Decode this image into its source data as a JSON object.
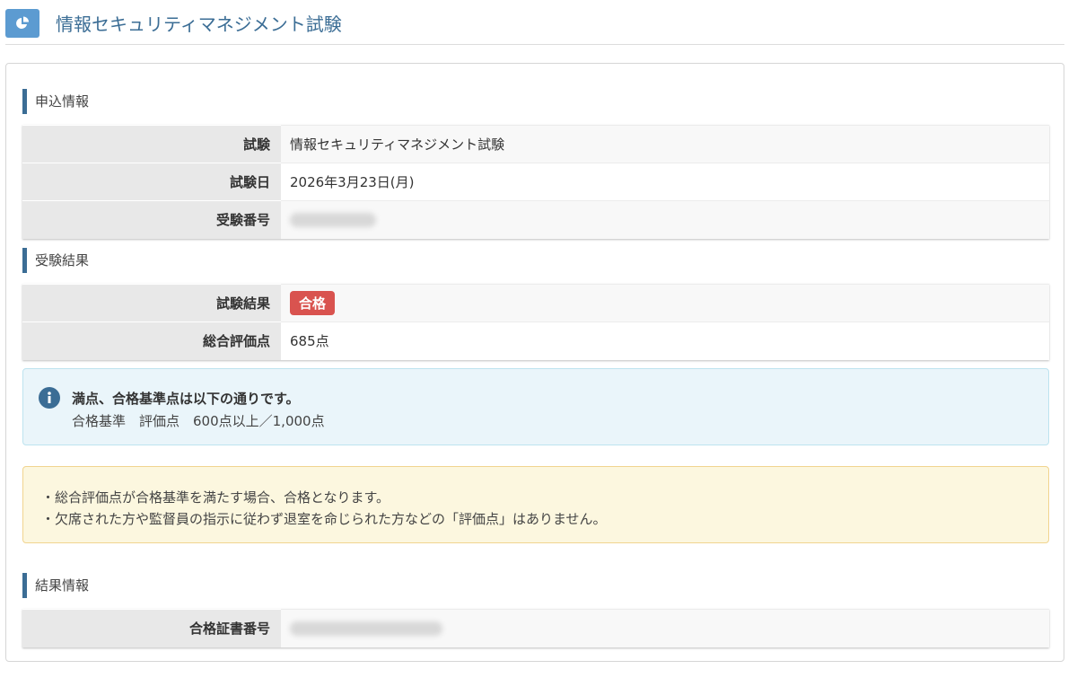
{
  "header": {
    "title": "情報セキュリティマネジメント試験",
    "icon": "pie-chart-icon"
  },
  "application_info": {
    "title": "申込情報",
    "rows": [
      {
        "label": "試験",
        "value": "情報セキュリティマネジメント試験"
      },
      {
        "label": "試験日",
        "value": "2026年3月23日(月)"
      },
      {
        "label": "受験番号",
        "value": ""
      }
    ]
  },
  "exam_result": {
    "title": "受験結果",
    "result_label": "試験結果",
    "result_value": "合格",
    "score_label": "総合評価点",
    "score_value": "685点"
  },
  "info_alert": {
    "heading": "満点、合格基準点は以下の通りです。",
    "text": "合格基準　評価点　600点以上／1,000点",
    "icon": "info-circle-icon"
  },
  "warning_alert": {
    "lines": [
      "・総合評価点が合格基準を満たす場合、合格となります。",
      "・欠席された方や監督員の指示に従わず退室を命じられた方などの「評価点」はありません。"
    ]
  },
  "result_info": {
    "title": "結果情報",
    "certificate_label": "合格証書番号",
    "certificate_value": ""
  },
  "colors": {
    "accent": "#3b6d95",
    "header_icon_bg": "#5c9bd1",
    "pass_badge": "#d9534f",
    "info_bg": "#eaf5fa",
    "warning_bg": "#fcf7df"
  }
}
